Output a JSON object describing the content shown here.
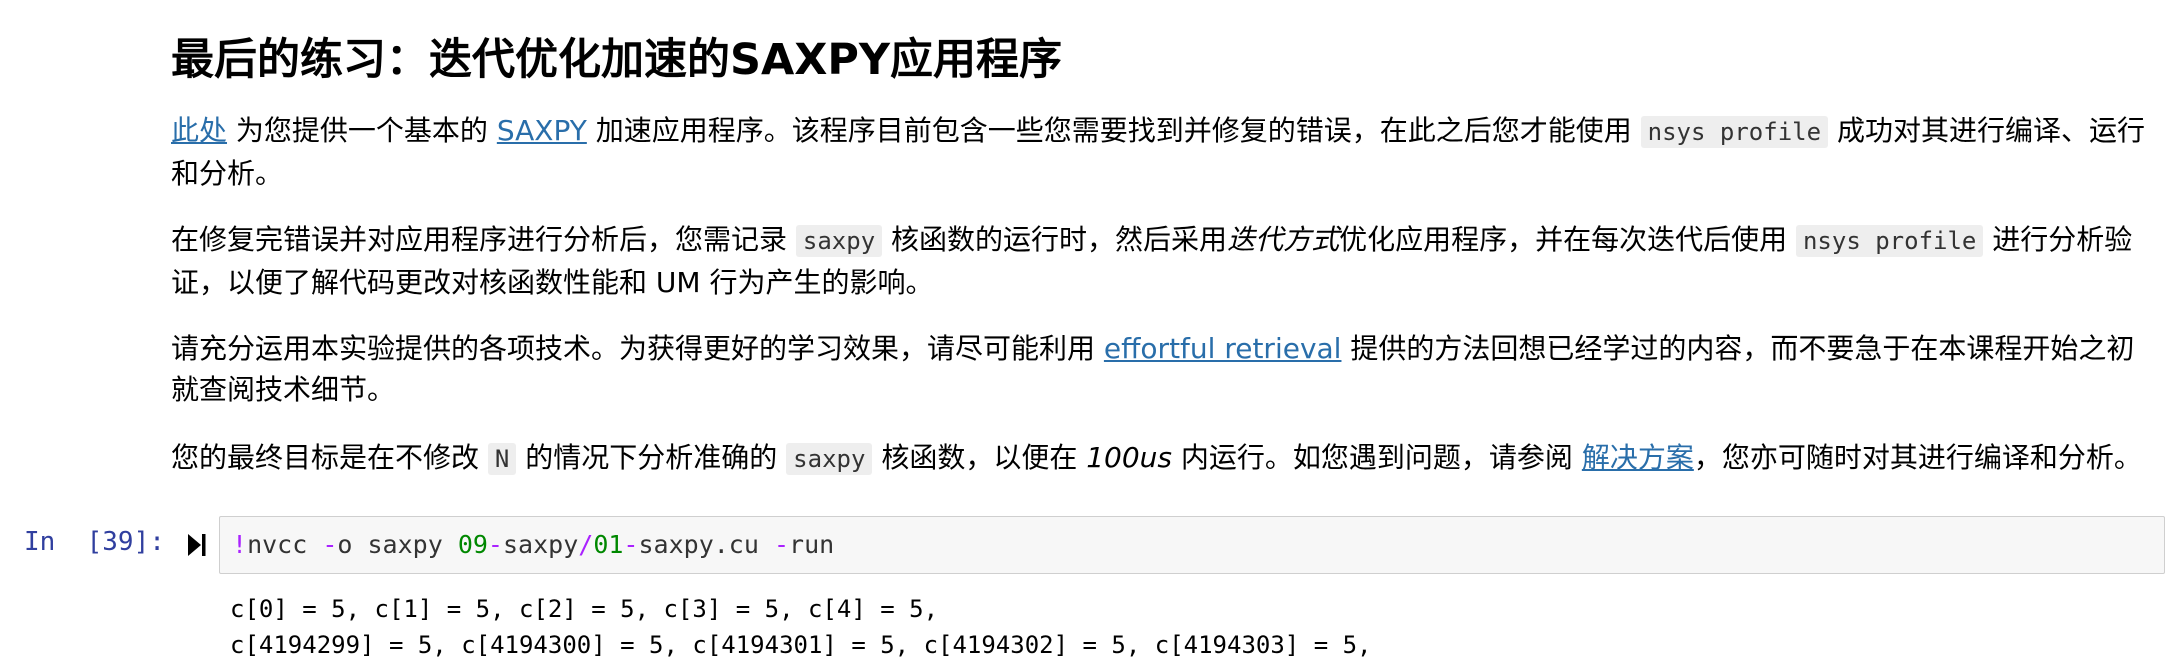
{
  "markdown": {
    "title": "最后的练习：迭代优化加速的SAXPY应用程序",
    "p1": {
      "link1": "此处",
      "t1": " 为您提供一个基本的 ",
      "link2": "SAXPY",
      "t2": " 加速应用程序。该程序目前包含一些您需要找到并修复的错误，在此之后您才能使用 ",
      "code1": "nsys profile",
      "t3": " 成功对其进行编译、运行和分析。"
    },
    "p2": {
      "t1": "在修复完错误并对应用程序进行分析后，您需记录 ",
      "code1": "saxpy",
      "t2": " 核函数的运行时，然后采用",
      "em1": "迭代方式",
      "t3": "优化应用程序，并在每次迭代后使用 ",
      "code2": "nsys profile",
      "t4": " 进行分析验证，以便了解代码更改对核函数性能和 UM 行为产生的影响。"
    },
    "p3": {
      "t1": "请充分运用本实验提供的各项技术。为获得更好的学习效果，请尽可能利用 ",
      "link1": "effortful retrieval",
      "t2": " 提供的方法回想已经学过的内容，而不要急于在本课程开始之初就查阅技术细节。"
    },
    "p4": {
      "t1": "您的最终目标是在不修改 ",
      "code1": "N",
      "t2": " 的情况下分析准确的 ",
      "code2": "saxpy",
      "t3": " 核函数，以便在 ",
      "em1": "100us",
      "t4": " 内运行。如您遇到问题，请参阅 ",
      "link1": "解决方案",
      "t5": "，您亦可随时对其进行编译和分析。"
    }
  },
  "code_cell": {
    "prompt": "In  [39]:",
    "run_icon": "run-cell-icon",
    "code_tokens": {
      "bang": "!",
      "cmd": "nvcc ",
      "opt1": "-",
      "o": "o saxpy ",
      "num1": "09",
      "dash1": "-",
      "saxpy": "saxpy",
      "slash": "/",
      "num2": "01",
      "dash2": "-",
      "file": "saxpy.cu ",
      "opt2": "-",
      "run": "run"
    },
    "output_lines": [
      "c[0] = 5, c[1] = 5, c[2] = 5, c[3] = 5, c[4] = 5, ",
      "c[4194299] = 5, c[4194300] = 5, c[4194301] = 5, c[4194302] = 5, c[4194303] = 5, "
    ]
  }
}
